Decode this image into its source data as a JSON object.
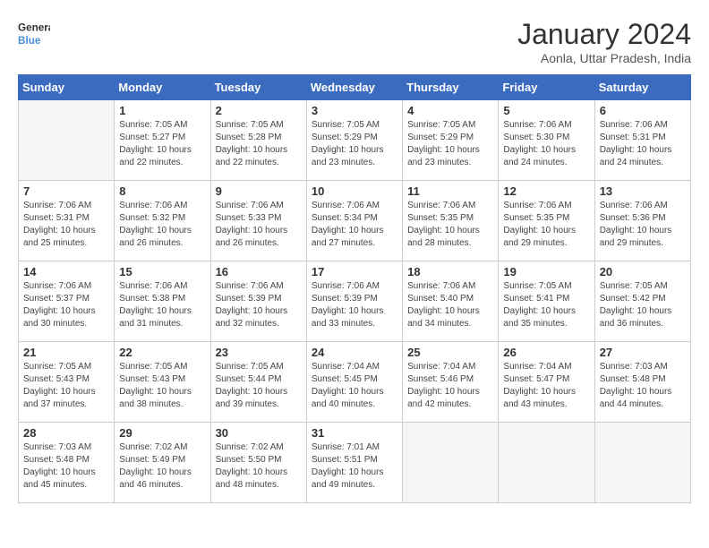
{
  "logo": {
    "line1": "General",
    "line2": "Blue"
  },
  "title": "January 2024",
  "location": "Aonla, Uttar Pradesh, India",
  "weekdays": [
    "Sunday",
    "Monday",
    "Tuesday",
    "Wednesday",
    "Thursday",
    "Friday",
    "Saturday"
  ],
  "weeks": [
    [
      {
        "day": "",
        "sunrise": "",
        "sunset": "",
        "daylight": ""
      },
      {
        "day": "1",
        "sunrise": "Sunrise: 7:05 AM",
        "sunset": "Sunset: 5:27 PM",
        "daylight": "Daylight: 10 hours and 22 minutes."
      },
      {
        "day": "2",
        "sunrise": "Sunrise: 7:05 AM",
        "sunset": "Sunset: 5:28 PM",
        "daylight": "Daylight: 10 hours and 22 minutes."
      },
      {
        "day": "3",
        "sunrise": "Sunrise: 7:05 AM",
        "sunset": "Sunset: 5:29 PM",
        "daylight": "Daylight: 10 hours and 23 minutes."
      },
      {
        "day": "4",
        "sunrise": "Sunrise: 7:05 AM",
        "sunset": "Sunset: 5:29 PM",
        "daylight": "Daylight: 10 hours and 23 minutes."
      },
      {
        "day": "5",
        "sunrise": "Sunrise: 7:06 AM",
        "sunset": "Sunset: 5:30 PM",
        "daylight": "Daylight: 10 hours and 24 minutes."
      },
      {
        "day": "6",
        "sunrise": "Sunrise: 7:06 AM",
        "sunset": "Sunset: 5:31 PM",
        "daylight": "Daylight: 10 hours and 24 minutes."
      }
    ],
    [
      {
        "day": "7",
        "sunrise": "Sunrise: 7:06 AM",
        "sunset": "Sunset: 5:31 PM",
        "daylight": "Daylight: 10 hours and 25 minutes."
      },
      {
        "day": "8",
        "sunrise": "Sunrise: 7:06 AM",
        "sunset": "Sunset: 5:32 PM",
        "daylight": "Daylight: 10 hours and 26 minutes."
      },
      {
        "day": "9",
        "sunrise": "Sunrise: 7:06 AM",
        "sunset": "Sunset: 5:33 PM",
        "daylight": "Daylight: 10 hours and 26 minutes."
      },
      {
        "day": "10",
        "sunrise": "Sunrise: 7:06 AM",
        "sunset": "Sunset: 5:34 PM",
        "daylight": "Daylight: 10 hours and 27 minutes."
      },
      {
        "day": "11",
        "sunrise": "Sunrise: 7:06 AM",
        "sunset": "Sunset: 5:35 PM",
        "daylight": "Daylight: 10 hours and 28 minutes."
      },
      {
        "day": "12",
        "sunrise": "Sunrise: 7:06 AM",
        "sunset": "Sunset: 5:35 PM",
        "daylight": "Daylight: 10 hours and 29 minutes."
      },
      {
        "day": "13",
        "sunrise": "Sunrise: 7:06 AM",
        "sunset": "Sunset: 5:36 PM",
        "daylight": "Daylight: 10 hours and 29 minutes."
      }
    ],
    [
      {
        "day": "14",
        "sunrise": "Sunrise: 7:06 AM",
        "sunset": "Sunset: 5:37 PM",
        "daylight": "Daylight: 10 hours and 30 minutes."
      },
      {
        "day": "15",
        "sunrise": "Sunrise: 7:06 AM",
        "sunset": "Sunset: 5:38 PM",
        "daylight": "Daylight: 10 hours and 31 minutes."
      },
      {
        "day": "16",
        "sunrise": "Sunrise: 7:06 AM",
        "sunset": "Sunset: 5:39 PM",
        "daylight": "Daylight: 10 hours and 32 minutes."
      },
      {
        "day": "17",
        "sunrise": "Sunrise: 7:06 AM",
        "sunset": "Sunset: 5:39 PM",
        "daylight": "Daylight: 10 hours and 33 minutes."
      },
      {
        "day": "18",
        "sunrise": "Sunrise: 7:06 AM",
        "sunset": "Sunset: 5:40 PM",
        "daylight": "Daylight: 10 hours and 34 minutes."
      },
      {
        "day": "19",
        "sunrise": "Sunrise: 7:05 AM",
        "sunset": "Sunset: 5:41 PM",
        "daylight": "Daylight: 10 hours and 35 minutes."
      },
      {
        "day": "20",
        "sunrise": "Sunrise: 7:05 AM",
        "sunset": "Sunset: 5:42 PM",
        "daylight": "Daylight: 10 hours and 36 minutes."
      }
    ],
    [
      {
        "day": "21",
        "sunrise": "Sunrise: 7:05 AM",
        "sunset": "Sunset: 5:43 PM",
        "daylight": "Daylight: 10 hours and 37 minutes."
      },
      {
        "day": "22",
        "sunrise": "Sunrise: 7:05 AM",
        "sunset": "Sunset: 5:43 PM",
        "daylight": "Daylight: 10 hours and 38 minutes."
      },
      {
        "day": "23",
        "sunrise": "Sunrise: 7:05 AM",
        "sunset": "Sunset: 5:44 PM",
        "daylight": "Daylight: 10 hours and 39 minutes."
      },
      {
        "day": "24",
        "sunrise": "Sunrise: 7:04 AM",
        "sunset": "Sunset: 5:45 PM",
        "daylight": "Daylight: 10 hours and 40 minutes."
      },
      {
        "day": "25",
        "sunrise": "Sunrise: 7:04 AM",
        "sunset": "Sunset: 5:46 PM",
        "daylight": "Daylight: 10 hours and 42 minutes."
      },
      {
        "day": "26",
        "sunrise": "Sunrise: 7:04 AM",
        "sunset": "Sunset: 5:47 PM",
        "daylight": "Daylight: 10 hours and 43 minutes."
      },
      {
        "day": "27",
        "sunrise": "Sunrise: 7:03 AM",
        "sunset": "Sunset: 5:48 PM",
        "daylight": "Daylight: 10 hours and 44 minutes."
      }
    ],
    [
      {
        "day": "28",
        "sunrise": "Sunrise: 7:03 AM",
        "sunset": "Sunset: 5:48 PM",
        "daylight": "Daylight: 10 hours and 45 minutes."
      },
      {
        "day": "29",
        "sunrise": "Sunrise: 7:02 AM",
        "sunset": "Sunset: 5:49 PM",
        "daylight": "Daylight: 10 hours and 46 minutes."
      },
      {
        "day": "30",
        "sunrise": "Sunrise: 7:02 AM",
        "sunset": "Sunset: 5:50 PM",
        "daylight": "Daylight: 10 hours and 48 minutes."
      },
      {
        "day": "31",
        "sunrise": "Sunrise: 7:01 AM",
        "sunset": "Sunset: 5:51 PM",
        "daylight": "Daylight: 10 hours and 49 minutes."
      },
      {
        "day": "",
        "sunrise": "",
        "sunset": "",
        "daylight": ""
      },
      {
        "day": "",
        "sunrise": "",
        "sunset": "",
        "daylight": ""
      },
      {
        "day": "",
        "sunrise": "",
        "sunset": "",
        "daylight": ""
      }
    ]
  ]
}
